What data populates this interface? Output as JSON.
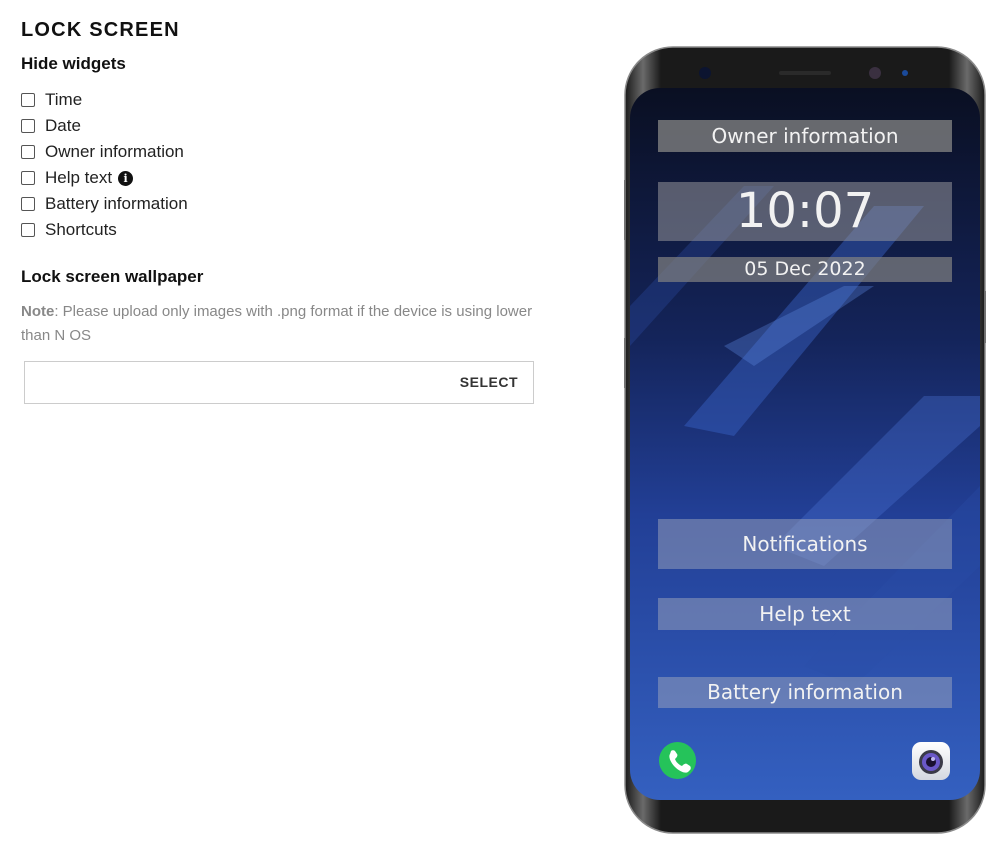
{
  "section": {
    "title": "LOCK SCREEN",
    "hide_widgets_heading": "Hide widgets"
  },
  "widgets_options": [
    {
      "label": "Time",
      "checked": false
    },
    {
      "label": "Date",
      "checked": false
    },
    {
      "label": "Owner information",
      "checked": false
    },
    {
      "label": "Help text",
      "checked": false,
      "info_icon": "info-icon"
    },
    {
      "label": "Battery information",
      "checked": false
    },
    {
      "label": "Shortcuts",
      "checked": false
    }
  ],
  "wallpaper": {
    "heading": "Lock screen wallpaper",
    "note_label": "Note",
    "note_text": ": Please upload only images with .png format if the device is using lower than N OS",
    "input_value": "",
    "select_label": "SELECT"
  },
  "preview": {
    "owner_information": "Owner information",
    "time": "10:07",
    "date": "05 Dec 2022",
    "notifications": "Notifications",
    "help_text": "Help text",
    "battery_information": "Battery information",
    "shortcut_left_icon": "phone-icon",
    "shortcut_right_icon": "camera-icon"
  },
  "colors": {
    "wallpaper_dark": "#0a1030",
    "wallpaper_blue": "#2a4ea8",
    "phone_shortcut": "#25c35a"
  }
}
